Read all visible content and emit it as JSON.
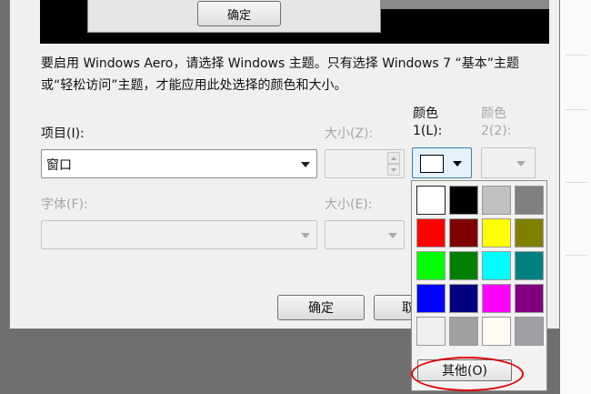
{
  "preview": {
    "ok_label": "确定"
  },
  "description": "要启用 Windows Aero，请选择 Windows 主题。只有选择 Windows 7 “基本”主题或“轻松访问”主题，才能应用此处选择的颜色和大小。",
  "form": {
    "item_label": "项目(I):",
    "item_value": "窗口",
    "size_label": "大小(Z):",
    "color1_label_line1": "颜色",
    "color1_label_line2": "1(L):",
    "color2_label_line1": "颜色",
    "color2_label_line2": "2(2):",
    "font_label": "字体(F):",
    "font_size_label": "大小(E):",
    "color1_value": "#ffffff"
  },
  "buttons": {
    "ok": "确定",
    "cancel": "取"
  },
  "palette": {
    "colors": [
      "#ffffff",
      "#000000",
      "#c0c0c0",
      "#808080",
      "#ff0000",
      "#800000",
      "#ffff00",
      "#808000",
      "#00ff00",
      "#008000",
      "#00ffff",
      "#008080",
      "#0000ff",
      "#000080",
      "#ff00ff",
      "#800080",
      "#f0f0f0",
      "#a0a0a0",
      "#fffbf0",
      "#a0a0a4"
    ],
    "other_label": "其他(O)"
  },
  "annotation": {
    "color": "#e00000"
  }
}
